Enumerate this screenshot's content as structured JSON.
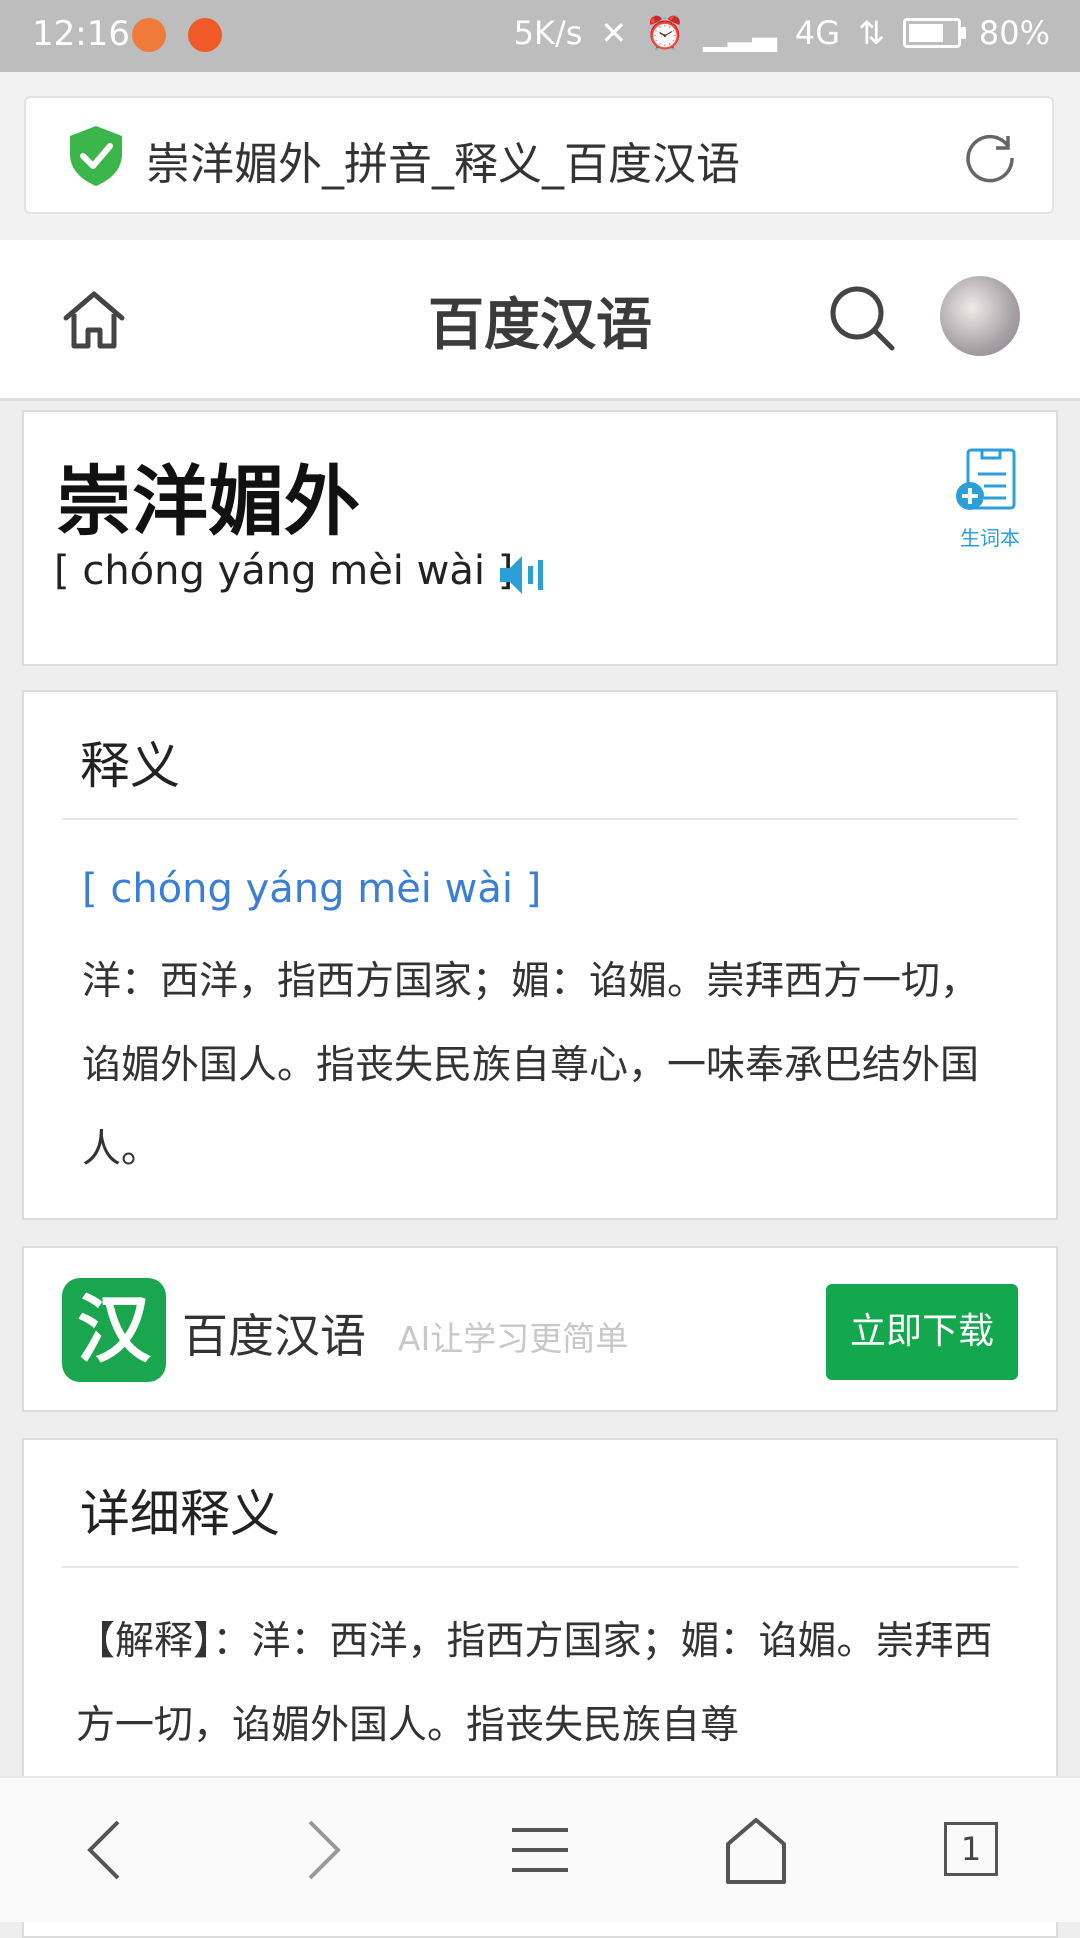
{
  "status_bar": {
    "time": "12:16",
    "speed": "5K/s",
    "network": "4G",
    "battery": "80%"
  },
  "browser": {
    "page_title": "崇洋媚外_拼音_释义_百度汉语",
    "secure_icon": "shield-check-icon",
    "refresh_icon": "refresh-icon"
  },
  "header": {
    "brand": "百度汉语",
    "home_icon": "home-icon",
    "search_icon": "search-icon"
  },
  "word": {
    "text": "崇洋媚外",
    "pinyin": "[ chóng yáng mèi wài ]",
    "vocab_label": "生词本"
  },
  "meaning": {
    "title": "释义",
    "pinyin": "[ chóng yáng mèi wài ]",
    "text": "洋：西洋，指西方国家；媚：谄媚。崇拜西方一切，谄媚外国人。指丧失民族自尊心，一味奉承巴结外国人。"
  },
  "app_banner": {
    "logo_char": "汉",
    "name": "百度汉语",
    "slogan": "AI让学习更简单",
    "button": "立即下载"
  },
  "detail": {
    "title": "详细释义",
    "text": "【解释】：洋：西洋，指西方国家；媚：谄媚。崇拜西方一切，谄媚外国人。指丧失民族自尊"
  },
  "bottom_nav": {
    "tab_count": "1"
  },
  "colors": {
    "accent_blue": "#3a7fd5",
    "download_green": "#14a84e",
    "secure_green": "#3cb54a"
  }
}
